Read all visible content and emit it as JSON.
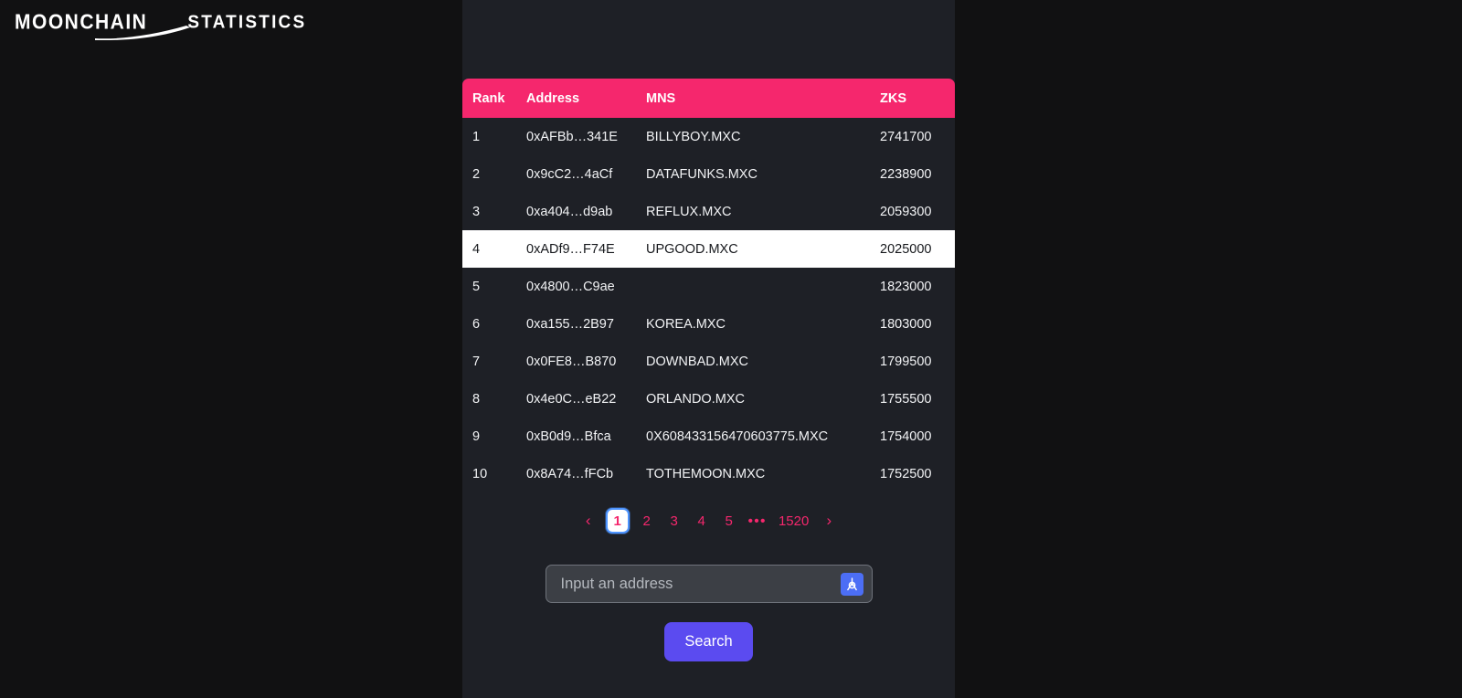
{
  "brand": {
    "name": "MOONCHAIN",
    "section": "STATISTICS",
    "logo_icon": "moonchain-swoosh-icon"
  },
  "table": {
    "columns": [
      "Rank",
      "Address",
      "MNS",
      "ZKS"
    ],
    "highlighted_rank": "4",
    "rows": [
      {
        "rank": "1",
        "address": "0xAFBb…341E",
        "mns": "BILLYBOY.MXC",
        "zks": "2741700"
      },
      {
        "rank": "2",
        "address": "0x9cC2…4aCf",
        "mns": "DATAFUNKS.MXC",
        "zks": "2238900"
      },
      {
        "rank": "3",
        "address": "0xa404…d9ab",
        "mns": "REFLUX.MXC",
        "zks": "2059300"
      },
      {
        "rank": "4",
        "address": "0xADf9…F74E",
        "mns": "UPGOOD.MXC",
        "zks": "2025000"
      },
      {
        "rank": "5",
        "address": "0x4800…C9ae",
        "mns": "",
        "zks": "1823000"
      },
      {
        "rank": "6",
        "address": "0xa155…2B97",
        "mns": "KOREA.MXC",
        "zks": "1803000"
      },
      {
        "rank": "7",
        "address": "0x0FE8…B870",
        "mns": "DOWNBAD.MXC",
        "zks": "1799500"
      },
      {
        "rank": "8",
        "address": "0x4e0C…eB22",
        "mns": "ORLANDO.MXC",
        "zks": "1755500"
      },
      {
        "rank": "9",
        "address": "0xB0d9…Bfca",
        "mns": "0X608433156470603775.MXC",
        "zks": "1754000"
      },
      {
        "rank": "10",
        "address": "0x8A74…fFCb",
        "mns": "TOTHEMOON.MXC",
        "zks": "1752500"
      }
    ]
  },
  "pagination": {
    "prev_label": "‹",
    "next_label": "›",
    "pages": [
      "1",
      "2",
      "3",
      "4",
      "5"
    ],
    "ellipsis": "•••",
    "last_page": "1520",
    "current_page": "1"
  },
  "search": {
    "placeholder": "Input an address",
    "value": "",
    "wallet_icon": "address-book-icon",
    "button_label": "Search"
  },
  "colors": {
    "accent_pink": "#f5276d",
    "button_blue": "#5b4bf0",
    "icon_blue": "#4c6ef5",
    "panel_bg": "#1e2026",
    "page_bg": "#111112",
    "active_page_border": "#4d94ff"
  }
}
